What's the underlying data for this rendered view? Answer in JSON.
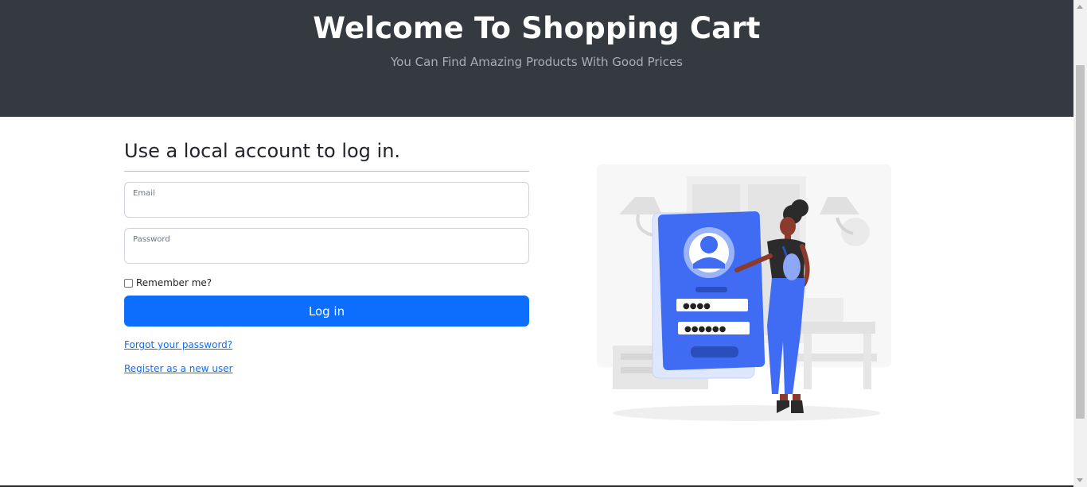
{
  "hero": {
    "title": "Welcome To Shopping Cart",
    "subtitle": "You Can Find Amazing Products With Good Prices"
  },
  "login": {
    "heading": "Use a local account to log in.",
    "email": {
      "label": "Email",
      "value": ""
    },
    "password": {
      "label": "Password",
      "value": ""
    },
    "remember_label": "Remember me?",
    "remember_checked": false,
    "submit_label": "Log in",
    "forgot_link": "Forgot your password?",
    "register_link": "Register as a new user"
  },
  "illustration": {
    "icon": "login-illustration",
    "masked_email": "●●●●",
    "masked_password": "●●●●●●"
  },
  "colors": {
    "hero_bg": "#343a40",
    "primary": "#0d6efd",
    "illustration_blue": "#3f6cf2"
  }
}
